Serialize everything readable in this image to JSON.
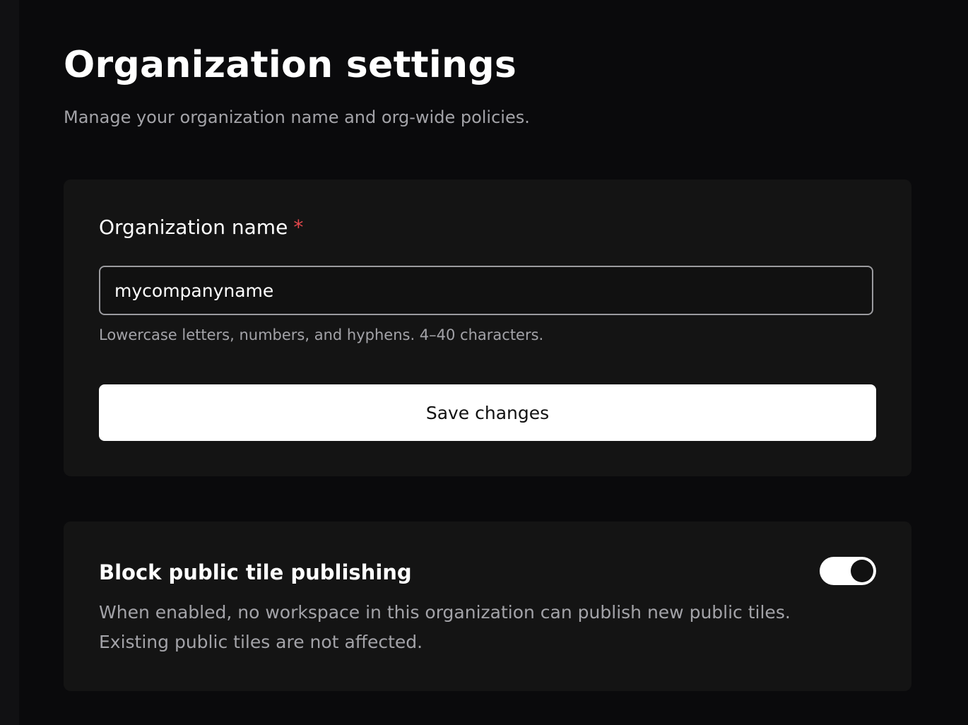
{
  "header": {
    "title": "Organization settings",
    "subtitle": "Manage your organization name and org-wide policies."
  },
  "org_name_card": {
    "label": "Organization name",
    "required_marker": "*",
    "input_value": "mycompanyname",
    "hint": "Lowercase letters, numbers, and hyphens. 4–40 characters.",
    "save_label": "Save changes"
  },
  "policy_card": {
    "title": "Block public tile publishing",
    "description_line1": "When enabled, no workspace in this organization can publish new public tiles.",
    "description_line2": "Existing public tiles are not affected.",
    "toggle_state": "on"
  },
  "colors": {
    "background": "#0a0a0c",
    "card": "#141414",
    "required": "#e5484d",
    "muted_text": "#a3a3a8"
  }
}
